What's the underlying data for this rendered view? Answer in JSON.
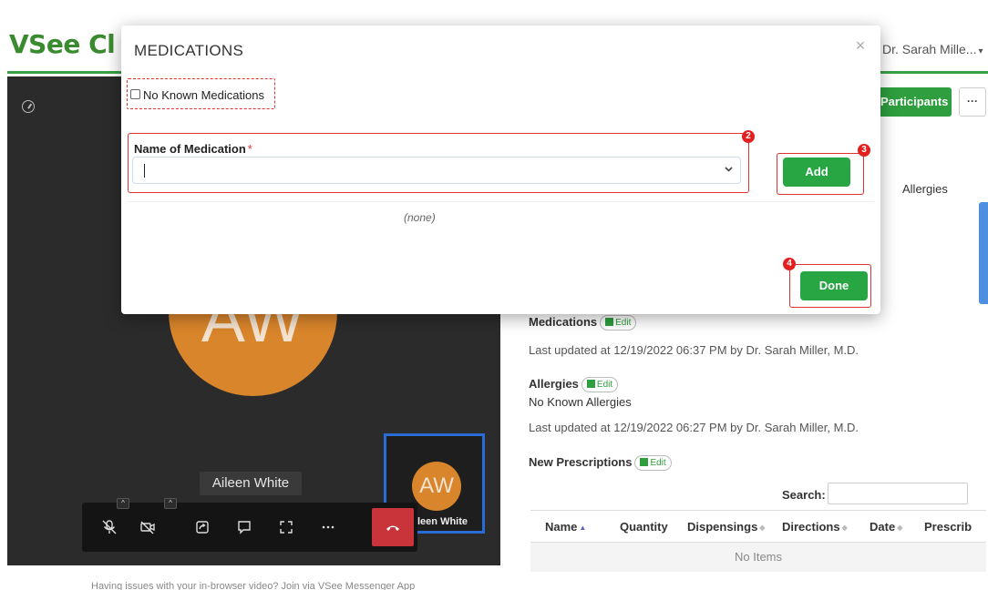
{
  "app": {
    "logo_text": "VSee Cl",
    "user_menu": "Dr. Sarah Mille...",
    "user_caret": "▾"
  },
  "video": {
    "big_avatar_initials": "AW",
    "participant_name": "Aileen White",
    "self_avatar_initials": "AW",
    "self_name": "leen White",
    "bottom_note": "Having issues with your in-browser video? Join via VSee Messenger App"
  },
  "toolbar": {
    "icons": [
      "mic-off-icon",
      "camera-off-icon",
      "share-screen-icon",
      "chat-icon",
      "fullscreen-icon",
      "more-icon",
      "end-call-icon"
    ]
  },
  "right_panel": {
    "participants_label": "Participants",
    "more_label": "···",
    "allergies_tab": "Allergies",
    "medications_title": "Medications",
    "edit_label": "Edit",
    "medications_updated": "Last updated at 12/19/2022 06:37 PM by Dr. Sarah Miller, M.D.",
    "allergies_title": "Allergies",
    "allergies_value": "No Known Allergies",
    "allergies_updated": "Last updated at 12/19/2022 06:27 PM by Dr. Sarah Miller, M.D.",
    "prescriptions_title": "New Prescriptions",
    "search_label": "Search:",
    "table_columns": [
      "Name",
      "Quantity",
      "Dispensings",
      "Directions",
      "Date",
      "Prescrib"
    ],
    "table_empty": "No Items"
  },
  "modal": {
    "title": "MEDICATIONS",
    "close": "×",
    "no_known_label": "No Known Medications",
    "no_known_checked": false,
    "field_label": "Name of Medication",
    "required_mark": "*",
    "input_value": "",
    "add_label": "Add",
    "empty_list": "(none)",
    "done_label": "Done",
    "markers": [
      "2",
      "3",
      "4"
    ]
  },
  "colors": {
    "brand_green": "#27a643",
    "annotation_red": "#e03030",
    "avatar_orange": "#d9852b",
    "end_call_red": "#c8343a"
  }
}
